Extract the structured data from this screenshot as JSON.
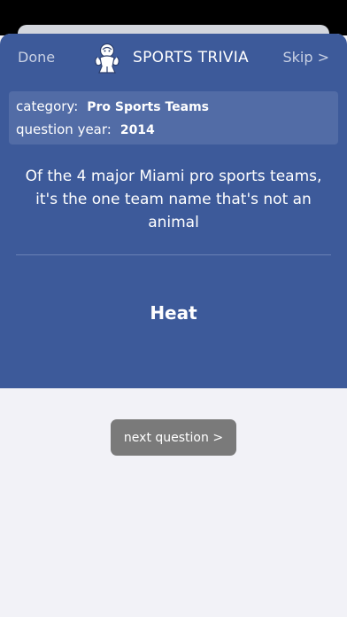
{
  "navbar": {
    "done_label": "Done",
    "title": "SPORTS TRIVIA",
    "skip_label": "Skip >",
    "logo_icon": "athlete-logo-icon"
  },
  "meta": {
    "category_label": "category:",
    "category_value": "Pro Sports Teams",
    "year_label": "question year:",
    "year_value": "2014"
  },
  "question": {
    "text": "Of the 4 major Miami pro sports teams, it's the one team name that's not an animal"
  },
  "answer": {
    "text": "Heat"
  },
  "footer": {
    "next_label": "next question >"
  },
  "colors": {
    "panel": "#3d5a9a",
    "meta_box": "#526ca6",
    "background": "#f2f2f7",
    "button": "#7a7a7a"
  }
}
